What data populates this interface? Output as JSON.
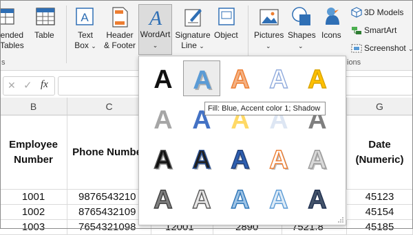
{
  "ribbon": {
    "extended_tables_label_1": "ended",
    "extended_tables_label_2": "Tables",
    "table_label": "Table",
    "text_box_label_1": "Text",
    "text_box_label_2": "Box",
    "header_footer_label_1": "Header",
    "header_footer_label_2": "& Footer",
    "wordart_label": "WordArt",
    "signature_line_label_1": "Signature",
    "signature_line_label_2": "Line",
    "object_label": "Object",
    "pictures_label": "Pictures",
    "shapes_label": "Shapes",
    "icons_label": "Icons",
    "models_3d_label": "3D Models",
    "smartart_label": "SmartArt",
    "screenshot_label": "Screenshot",
    "group_left_fragment": "s",
    "group_right_fragment": "ions",
    "chevron": "⌄"
  },
  "formula_bar": {
    "cancel_glyph": "✕",
    "enter_glyph": "✓",
    "fx_label": "fx",
    "value": ""
  },
  "columns": [
    "B",
    "C",
    "G"
  ],
  "table": {
    "header_b": "Employee Number",
    "header_c": "Phone Number",
    "header_g": "Date (Numeric)",
    "rows": [
      {
        "b": "1001",
        "c": "9876543210",
        "g": "45123"
      },
      {
        "b": "1002",
        "c": "8765432109",
        "g": "45154"
      },
      {
        "b": "1003",
        "c": "7654321098",
        "d": "12001",
        "e": "2890",
        "f": "7521.8",
        "g": "45185"
      }
    ]
  },
  "wordart_gallery": {
    "tooltip": "Fill: Blue, Accent color 1; Shadow",
    "letter": "A",
    "styles": [
      {
        "name": "fill-black-text",
        "fill": "#111111"
      },
      {
        "name": "fill-blue-accent1-shadow",
        "fill": "#5b9bd5",
        "selected": true
      },
      {
        "name": "fill-orange-accent2-outline",
        "fill": "#f4b183",
        "stroke": "#ed7d31"
      },
      {
        "name": "fill-white-outline-accent1",
        "fill": "#ffffff",
        "stroke": "#8faadc"
      },
      {
        "name": "fill-gold-accent4",
        "fill": "#ffc000",
        "stroke": "#d9a400"
      },
      {
        "name": "fill-gray-50",
        "fill": "#a6a6a6"
      },
      {
        "name": "fill-blue-reflection",
        "fill": "#4472c4"
      },
      {
        "name": "fill-gold-reflection",
        "fill": "#ffd966"
      },
      {
        "name": "fill-white-reflection",
        "fill": "#dde6f3"
      },
      {
        "name": "fill-gray-reflection",
        "fill": "#7f7f7f"
      },
      {
        "name": "fill-black-shadow",
        "fill": "#111111",
        "stroke": "#555555"
      },
      {
        "name": "fill-black-blue-shadow",
        "fill": "#1f1f1f",
        "stroke": "#2f5597"
      },
      {
        "name": "gradient-blue",
        "fill": "#2e5fb0",
        "stroke": "#1f3f7a"
      },
      {
        "name": "fill-white-orange-outline",
        "fill": "#ffffff",
        "stroke": "#ed7d31"
      },
      {
        "name": "gradient-silver",
        "fill": "#d9d9d9",
        "stroke": "#9a9a9a"
      },
      {
        "name": "pattern-gray",
        "fill": "#7f7f7f",
        "stroke": "#404040"
      },
      {
        "name": "pattern-white-gray",
        "fill": "#e7e6e6",
        "stroke": "#595959"
      },
      {
        "name": "pattern-blue",
        "fill": "#9dc3e6",
        "stroke": "#2e75b6"
      },
      {
        "name": "pattern-light-blue",
        "fill": "#deebf7",
        "stroke": "#5b9bd5"
      },
      {
        "name": "pattern-dark-blue",
        "fill": "#44546a",
        "stroke": "#1f2f4f"
      }
    ]
  }
}
